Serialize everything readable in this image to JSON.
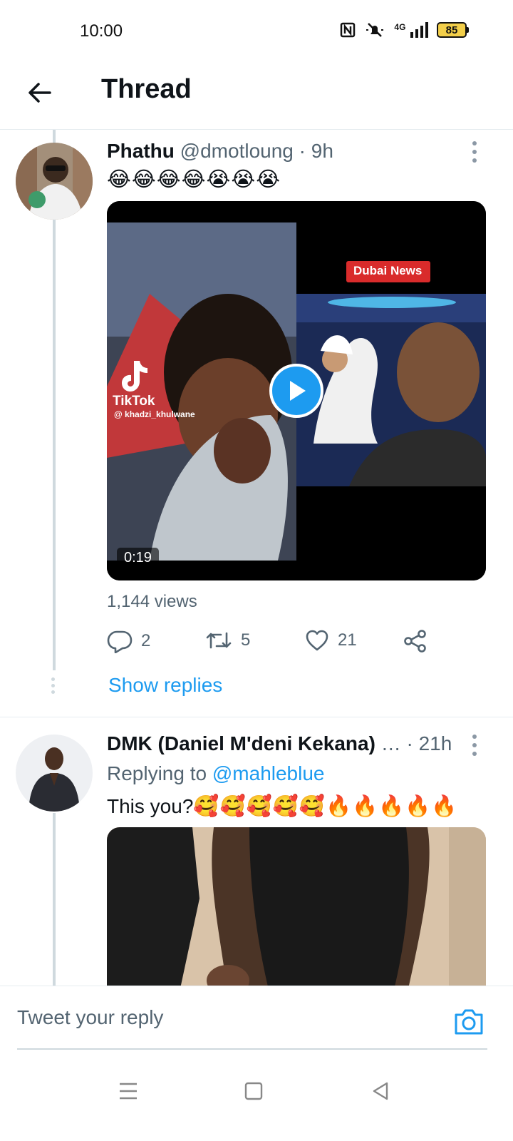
{
  "status_bar": {
    "time": "10:00",
    "network": "4G",
    "battery": "85",
    "icons": [
      "nfc-icon",
      "mute-icon",
      "signal-icon",
      "battery-icon"
    ]
  },
  "header": {
    "title": "Thread",
    "back_icon": "arrow-left-icon"
  },
  "tweet1": {
    "name": "Phathu",
    "handle": "@dmotloung",
    "separator": "·",
    "time": "9h",
    "text": "😂😂😂😂😭😭😭",
    "video": {
      "overlay_label": "Dubai News",
      "tiktok_label": "TikTok",
      "tiktok_user": "@ khadzi_khulwane",
      "duration": "0:19"
    },
    "views": "1,144 views",
    "replies": "2",
    "retweets": "5",
    "likes": "21",
    "show_replies": "Show replies"
  },
  "tweet2": {
    "name": "DMK (Daniel M'deni Kekana)",
    "truncation": "…",
    "separator": "·",
    "time": "21h",
    "replying_prefix": "Replying to",
    "replying_to": "@mahleblue",
    "text": "This you?",
    "emoji": "🥰🥰🥰🥰🥰🔥🔥🔥🔥🔥"
  },
  "reply_bar": {
    "placeholder": "Tweet your reply"
  },
  "colors": {
    "accent": "#1d9bf0",
    "secondary_text": "#536471",
    "thread_line": "#cfd9de"
  }
}
